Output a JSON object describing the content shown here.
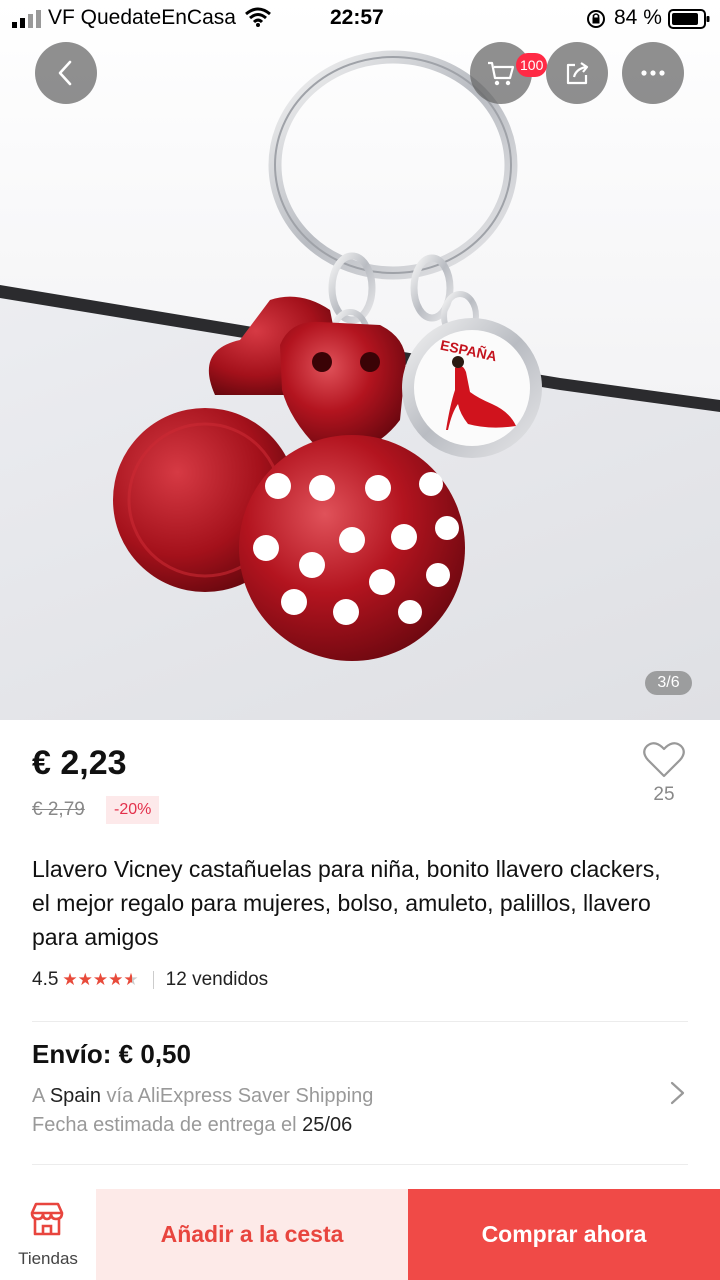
{
  "status_bar": {
    "carrier": "VF QuedateEnCasa",
    "time": "22:57",
    "battery": "84 %"
  },
  "header": {
    "cart_badge": "100",
    "icons": [
      "back-icon",
      "cart-icon",
      "share-icon",
      "more-icon"
    ]
  },
  "gallery": {
    "counter": "3/6",
    "charm_text": "ESPAÑA"
  },
  "product": {
    "price": "€ 2,23",
    "old_price": "€ 2,79",
    "discount": "-20%",
    "wishlist_count": "25",
    "title": "Llavero Vicney castañuelas para niña, bonito llavero clackers, el mejor regalo para mujeres, bolso, amuleto, palillos, llavero para amigos",
    "rating": "4.5",
    "rating_value": 4.5,
    "rating_max": 5,
    "sold": "12 vendidos"
  },
  "shipping": {
    "title": "Envío: € 0,50",
    "to_prefix": "A",
    "destination": "Spain",
    "method": "vía AliExpress Saver Shipping",
    "date_prefix": "Fecha estimada de entrega el",
    "date": "25/06"
  },
  "bottom_bar": {
    "stores_label": "Tiendas",
    "add_to_cart": "Añadir a la cesta",
    "buy_now": "Comprar ahora"
  },
  "colors": {
    "accent": "#f04a47",
    "accent_light": "#fdeae8",
    "star": "#e84a3a",
    "discount_text": "#e3304b"
  }
}
